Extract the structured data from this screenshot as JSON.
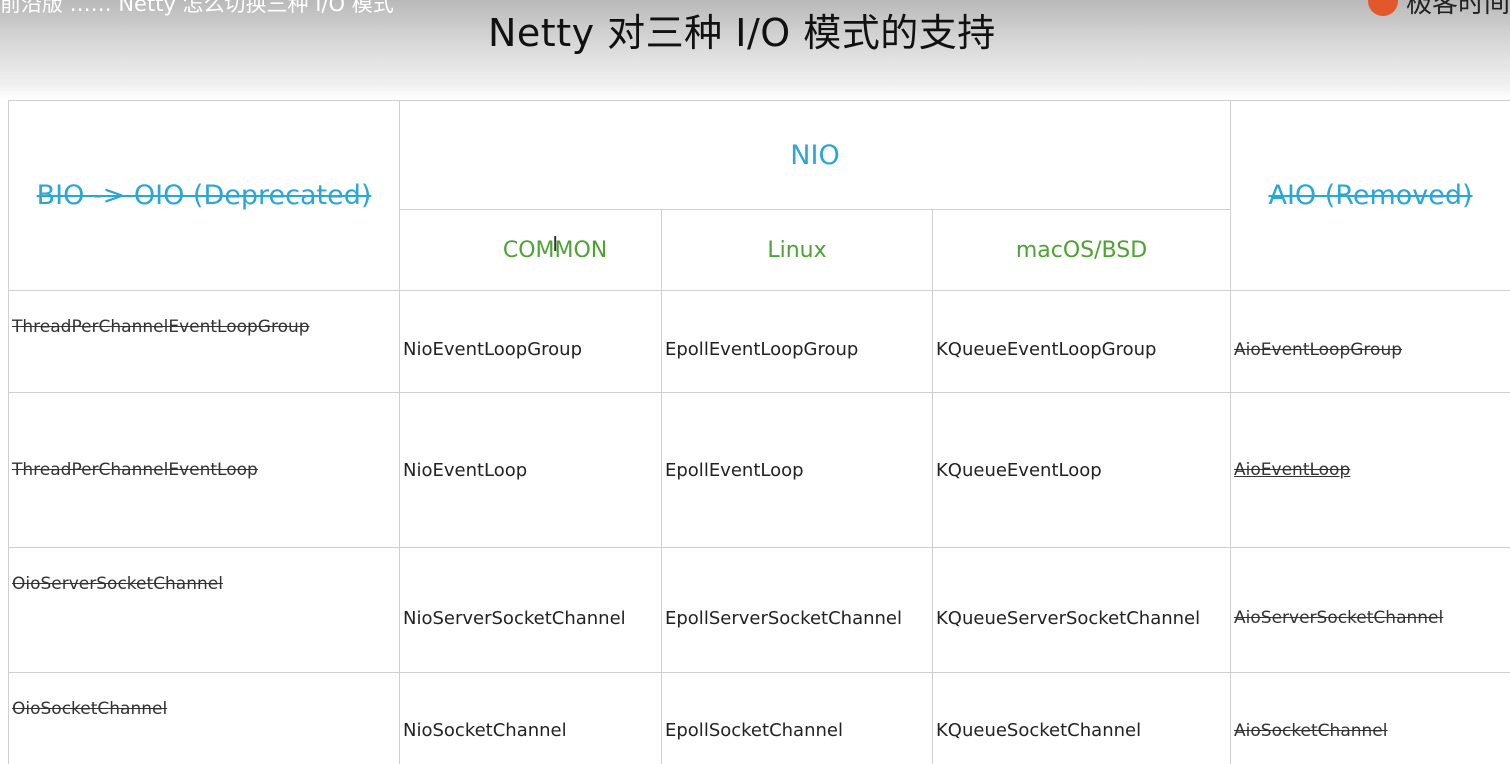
{
  "slide": {
    "top_caption": "前沿版 …… Netty 怎么切换三种 I/O 模式",
    "title": "Netty 对三种 I/O 模式的支持",
    "logo_text": "极客时间"
  },
  "table": {
    "headers": {
      "bio": "BIO -> OIO (Deprecated)",
      "nio": "NIO",
      "aio": "AIO (Removed)",
      "nio_sub": [
        "COMMON",
        "Linux",
        "macOS/BSD"
      ]
    },
    "rows": [
      {
        "bio": "ThreadPerChannelEventLoopGroup",
        "common": "NioEventLoopGroup",
        "linux": "EpollEventLoopGroup",
        "macos": "KQueueEventLoopGroup",
        "aio": "AioEventLoopGroup"
      },
      {
        "bio": "ThreadPerChannelEventLoop",
        "common": "NioEventLoop",
        "linux": "EpollEventLoop",
        "macos": "KQueueEventLoop",
        "aio": "AioEventLoop"
      },
      {
        "bio": "OioServerSocketChannel",
        "common": "NioServerSocketChannel",
        "linux": "EpollServerSocketChannel",
        "macos": "KQueueServerSocketChannel",
        "aio": "AioServerSocketChannel"
      },
      {
        "bio": "OioSocketChannel",
        "common": "NioSocketChannel",
        "linux": "EpollSocketChannel",
        "macos": "KQueueSocketChannel",
        "aio": "AioSocketChannel"
      }
    ]
  },
  "colors": {
    "header_blue": "#2aa6d8",
    "header_green": "#4ea233",
    "logo_orange": "#e2572b"
  },
  "icons": {
    "cursor": "text-cursor-icon"
  }
}
